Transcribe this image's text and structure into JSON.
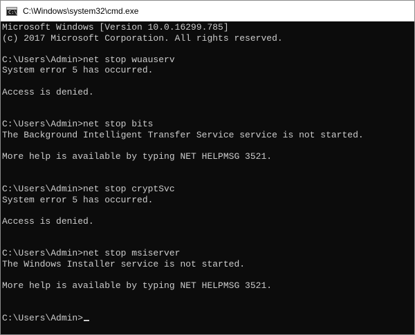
{
  "window": {
    "title": "C:\\Windows\\system32\\cmd.exe",
    "icon": "cmd-icon",
    "icon_text": "C:\\"
  },
  "console": {
    "lines": [
      "Microsoft Windows [Version 10.0.16299.785]",
      "(c) 2017 Microsoft Corporation. All rights reserved.",
      "",
      "C:\\Users\\Admin>net stop wuauserv",
      "System error 5 has occurred.",
      "",
      "Access is denied.",
      "",
      "",
      "C:\\Users\\Admin>net stop bits",
      "The Background Intelligent Transfer Service service is not started.",
      "",
      "More help is available by typing NET HELPMSG 3521.",
      "",
      "",
      "C:\\Users\\Admin>net stop cryptSvc",
      "System error 5 has occurred.",
      "",
      "Access is denied.",
      "",
      "",
      "C:\\Users\\Admin>net stop msiserver",
      "The Windows Installer service is not started.",
      "",
      "More help is available by typing NET HELPMSG 3521.",
      "",
      ""
    ],
    "prompt": "C:\\Users\\Admin>"
  },
  "colors": {
    "background": "#0c0c0c",
    "foreground": "#cccccc",
    "titlebar": "#ffffff"
  }
}
